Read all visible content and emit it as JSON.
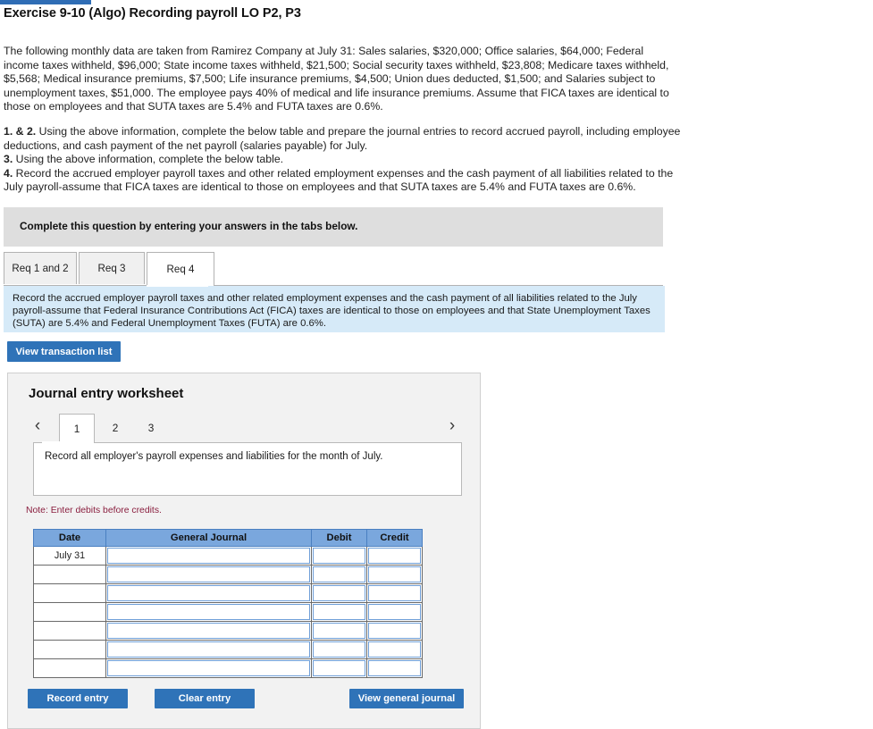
{
  "header": {
    "title": "Exercise 9-10 (Algo) Recording payroll LO P2, P3"
  },
  "problem": {
    "text": "The following monthly data are taken from Ramirez Company at July 31: Sales salaries, $320,000; Office salaries, $64,000; Federal income taxes withheld, $96,000; State income taxes withheld, $21,500; Social security taxes withheld, $23,808; Medicare taxes withheld, $5,568; Medical insurance premiums, $7,500; Life insurance premiums, $4,500; Union dues deducted, $1,500; and Salaries subject to unemployment taxes, $51,000. The employee pays 40% of medical and life insurance premiums. Assume that FICA taxes are identical to those on employees and that SUTA taxes are 5.4% and FUTA taxes are 0.6%."
  },
  "requirements": [
    {
      "num": "1. & 2.",
      "text": " Using the above information, complete the below table and prepare the journal entries to record accrued payroll, including employee deductions, and cash payment of the net payroll (salaries payable) for July."
    },
    {
      "num": "3.",
      "text": " Using the above information, complete the below table."
    },
    {
      "num": "4.",
      "text": " Record the accrued employer payroll taxes and other related employment expenses and the cash payment of all liabilities related to the July payroll-assume that FICA taxes are identical to those on employees and that SUTA taxes are 5.4% and FUTA taxes are 0.6%."
    }
  ],
  "instruction_bar": {
    "text": "Complete this question by entering your answers in the tabs below."
  },
  "tabs": [
    {
      "label": "Req 1 and 2",
      "active": false
    },
    {
      "label": "Req 3",
      "active": false
    },
    {
      "label": "Req 4",
      "active": true
    }
  ],
  "info_panel": {
    "text": "Record the accrued employer payroll taxes and other related employment expenses and the cash payment of all liabilities related to the July payroll-assume that Federal Insurance Contributions Act (FICA) taxes are identical to those on employees and that State Unemployment Taxes (SUTA) are 5.4% and Federal Unemployment Taxes (FUTA) are 0.6%."
  },
  "buttons": {
    "view_transaction_list": "View transaction list",
    "record_entry": "Record entry",
    "clear_entry": "Clear entry",
    "view_general_journal": "View general journal"
  },
  "worksheet": {
    "title": "Journal entry worksheet",
    "prev_arrow": "‹",
    "next_arrow": "›",
    "pages": [
      {
        "label": "1",
        "active": true
      },
      {
        "label": "2",
        "active": false
      },
      {
        "label": "3",
        "active": false
      }
    ],
    "transaction_text": "Record all employer's payroll expenses and liabilities for the month of July.",
    "note": "Note: Enter debits before credits.",
    "table": {
      "columns": [
        "Date",
        "General Journal",
        "Debit",
        "Credit"
      ],
      "rows": [
        {
          "date": "July 31",
          "general_journal": "",
          "debit": "",
          "credit": ""
        },
        {
          "date": "",
          "general_journal": "",
          "debit": "",
          "credit": ""
        },
        {
          "date": "",
          "general_journal": "",
          "debit": "",
          "credit": ""
        },
        {
          "date": "",
          "general_journal": "",
          "debit": "",
          "credit": ""
        },
        {
          "date": "",
          "general_journal": "",
          "debit": "",
          "credit": ""
        },
        {
          "date": "",
          "general_journal": "",
          "debit": "",
          "credit": ""
        },
        {
          "date": "",
          "general_journal": "",
          "debit": "",
          "credit": ""
        }
      ]
    }
  },
  "colors": {
    "accent_blue": "#2f73b8",
    "info_blue": "#d6eaf8",
    "bar_gray": "#dedede",
    "header_blue": "#7aa7dd",
    "note_red": "#8a1f3f"
  }
}
